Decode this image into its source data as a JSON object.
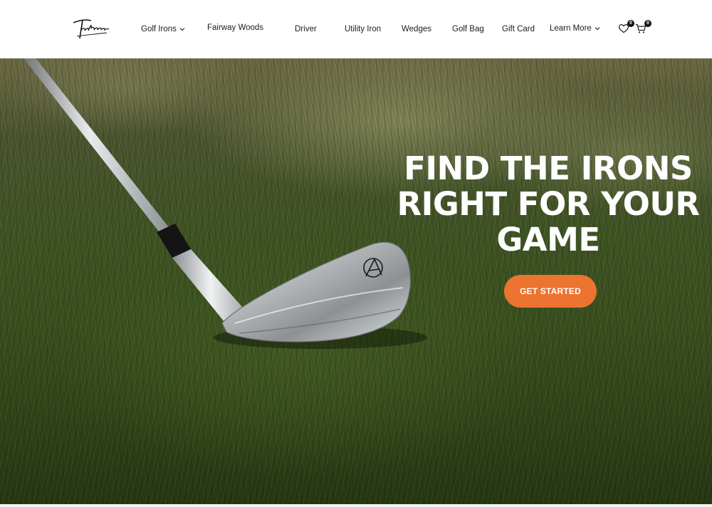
{
  "header": {
    "logo_text": "Takomo",
    "nav": [
      {
        "label": "Golf Irons",
        "has_dropdown": true
      },
      {
        "label": "Fairway Woods",
        "has_dropdown": false
      },
      {
        "label": "Driver",
        "has_dropdown": false
      },
      {
        "label": "Utility Iron",
        "has_dropdown": false
      },
      {
        "label": "Wedges",
        "has_dropdown": false
      },
      {
        "label": "Golf Bag",
        "has_dropdown": false
      },
      {
        "label": "Gift Card",
        "has_dropdown": false
      },
      {
        "label": "Learn More",
        "has_dropdown": true
      }
    ],
    "wishlist": {
      "icon": "heart-icon",
      "count": "0"
    },
    "cart": {
      "icon": "cart-icon",
      "count": "0"
    }
  },
  "hero": {
    "title_lines": [
      "FIND THE IRONS",
      "RIGHT FOR YOUR",
      "GAME"
    ],
    "cta_label": "GET STARTED",
    "image": "golf-iron-on-grass"
  },
  "colors": {
    "accent": "#ec7330",
    "text_dark": "#1c1c1c",
    "white": "#ffffff"
  }
}
